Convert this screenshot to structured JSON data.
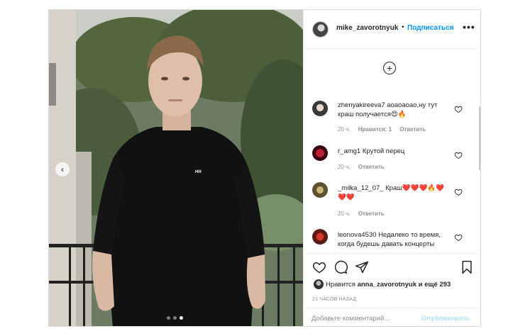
{
  "post": {
    "author": {
      "username": "mike_zavorotnyuk",
      "separator": "•",
      "follow_label": "Подписаться",
      "more_icon": "more-dots-icon"
    },
    "photo": {
      "carousel_dots": 3,
      "active_dot": 3,
      "nav_icon": "chevron-left-icon",
      "shirt_logo": "HH"
    },
    "comments": [
      {
        "username": "zhenyakireeva7",
        "text": "аоаоаоао,ну тут краш получается😍🔥",
        "time": "20 ч.",
        "likes": "Нравится: 1",
        "reply": "Ответить"
      },
      {
        "username": "r_amg1",
        "text": "Крутой перец",
        "time": "20 ч.",
        "reply": "Ответить"
      },
      {
        "username": "_milka_12_07_",
        "text": "Краш❤️❤️❤️🔥❤️❤️❤️",
        "time": "20 ч.",
        "reply": "Ответить"
      },
      {
        "username": "leonova4530",
        "text": "Недалеко то время, когда будешь давать концерты",
        "time": "",
        "reply": ""
      }
    ],
    "likes_summary": {
      "prefix": "Нравится",
      "user": "anna_zavorotnyuk",
      "suffix": "и ещё 293"
    },
    "timestamp": "21 ЧАСОВ НАЗАД",
    "add_comment": {
      "placeholder": "Добавьте комментарий...",
      "publish_label": "Опубликовать"
    }
  }
}
